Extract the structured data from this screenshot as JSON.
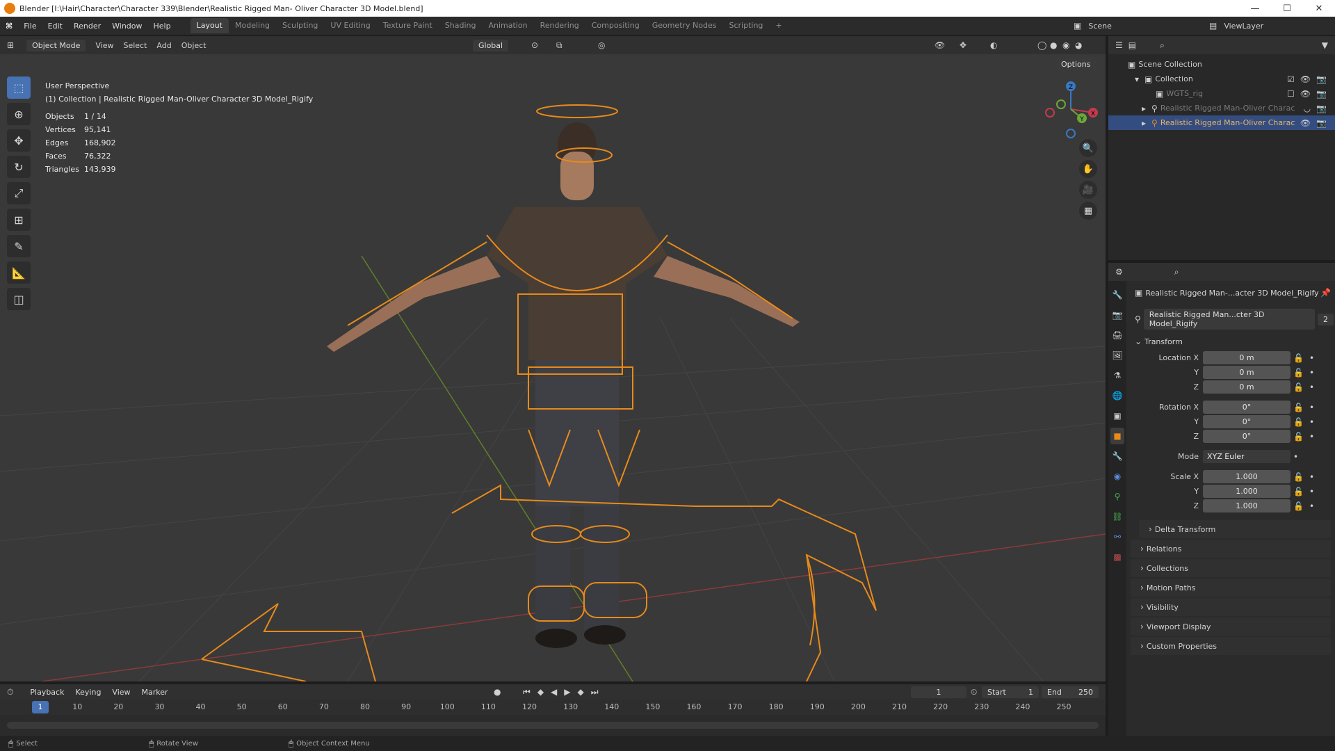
{
  "titlebar": {
    "title": "Blender [I:\\Hair\\Character\\Character 339\\Blender\\Realistic Rigged Man- Oliver Character 3D Model.blend]",
    "minimize_icon": "minimize-icon",
    "maximize_icon": "maximize-icon",
    "close_icon": "close-icon"
  },
  "menubar": {
    "menus": [
      "File",
      "Edit",
      "Render",
      "Window",
      "Help"
    ],
    "workspaces": [
      "Layout",
      "Modeling",
      "Sculpting",
      "UV Editing",
      "Texture Paint",
      "Shading",
      "Animation",
      "Rendering",
      "Compositing",
      "Geometry Nodes",
      "Scripting"
    ],
    "active_workspace": "Layout",
    "add_workspace": "+",
    "scene_label": "Scene",
    "viewlayer_label": "ViewLayer"
  },
  "viewport_header": {
    "mode": "Object Mode",
    "menus": [
      "View",
      "Select",
      "Add",
      "Object"
    ],
    "orientation": "Global",
    "options_label": "Options"
  },
  "viewport": {
    "perspective": "User Perspective",
    "collection_info": "(1) Collection | Realistic Rigged Man-Oliver Character 3D Model_Rigify",
    "stats": [
      {
        "label": "Objects",
        "value": "1 / 14"
      },
      {
        "label": "Vertices",
        "value": "95,141"
      },
      {
        "label": "Edges",
        "value": "168,902"
      },
      {
        "label": "Faces",
        "value": "76,322"
      },
      {
        "label": "Triangles",
        "value": "143,939"
      }
    ],
    "gizmo_axes": [
      "X",
      "Y",
      "Z"
    ]
  },
  "toolbar": {
    "tools": [
      "select-box-icon",
      "cursor-icon",
      "move-icon",
      "rotate-icon",
      "scale-icon",
      "transform-icon",
      "annotate-icon",
      "measure-icon",
      "add-cube-icon"
    ]
  },
  "outliner": {
    "rows": [
      {
        "label": "Scene Collection",
        "indent": 0,
        "state": "normal"
      },
      {
        "label": "Collection",
        "indent": 1,
        "state": "normal"
      },
      {
        "label": "WGTS_rig",
        "indent": 2,
        "state": "dim"
      },
      {
        "label": "Realistic Rigged Man-Oliver Charac",
        "indent": 2,
        "state": "dim"
      },
      {
        "label": "Realistic Rigged Man-Oliver Charac",
        "indent": 2,
        "state": "selected"
      }
    ]
  },
  "properties": {
    "object_name": "Realistic Rigged Man-...acter 3D Model_Rigify",
    "data_name": "Realistic Rigged Man...cter 3D Model_Rigify",
    "users": "2",
    "transform_label": "Transform",
    "location_x_label": "Location X",
    "location_x": "0 m",
    "location_y_label": "Y",
    "location_y": "0 m",
    "location_z_label": "Z",
    "location_z": "0 m",
    "rotation_x_label": "Rotation X",
    "rotation_x": "0°",
    "rotation_y_label": "Y",
    "rotation_y": "0°",
    "rotation_z_label": "Z",
    "rotation_z": "0°",
    "mode_label": "Mode",
    "mode_value": "XYZ Euler",
    "scale_x_label": "Scale X",
    "scale_x": "1.000",
    "scale_y_label": "Y",
    "scale_y": "1.000",
    "scale_z_label": "Z",
    "scale_z": "1.000",
    "delta_transform": "Delta Transform",
    "panels": [
      "Relations",
      "Collections",
      "Motion Paths",
      "Visibility",
      "Viewport Display",
      "Custom Properties"
    ]
  },
  "timeline": {
    "menus": [
      "Playback",
      "Keying",
      "View",
      "Marker"
    ],
    "current_frame": "1",
    "start_label": "Start",
    "start": "1",
    "end_label": "End",
    "end": "250",
    "ticks": [
      "1",
      "10",
      "20",
      "30",
      "40",
      "50",
      "60",
      "70",
      "80",
      "90",
      "100",
      "110",
      "120",
      "130",
      "140",
      "150",
      "160",
      "170",
      "180",
      "190",
      "200",
      "210",
      "220",
      "230",
      "240",
      "250"
    ]
  },
  "statusbar": {
    "items": [
      "Select",
      "Rotate View",
      "Object Context Menu"
    ]
  },
  "colors": {
    "accent": "#4772b3",
    "selection_orange": "#e88a1a",
    "viewport_bg": "#393939"
  }
}
